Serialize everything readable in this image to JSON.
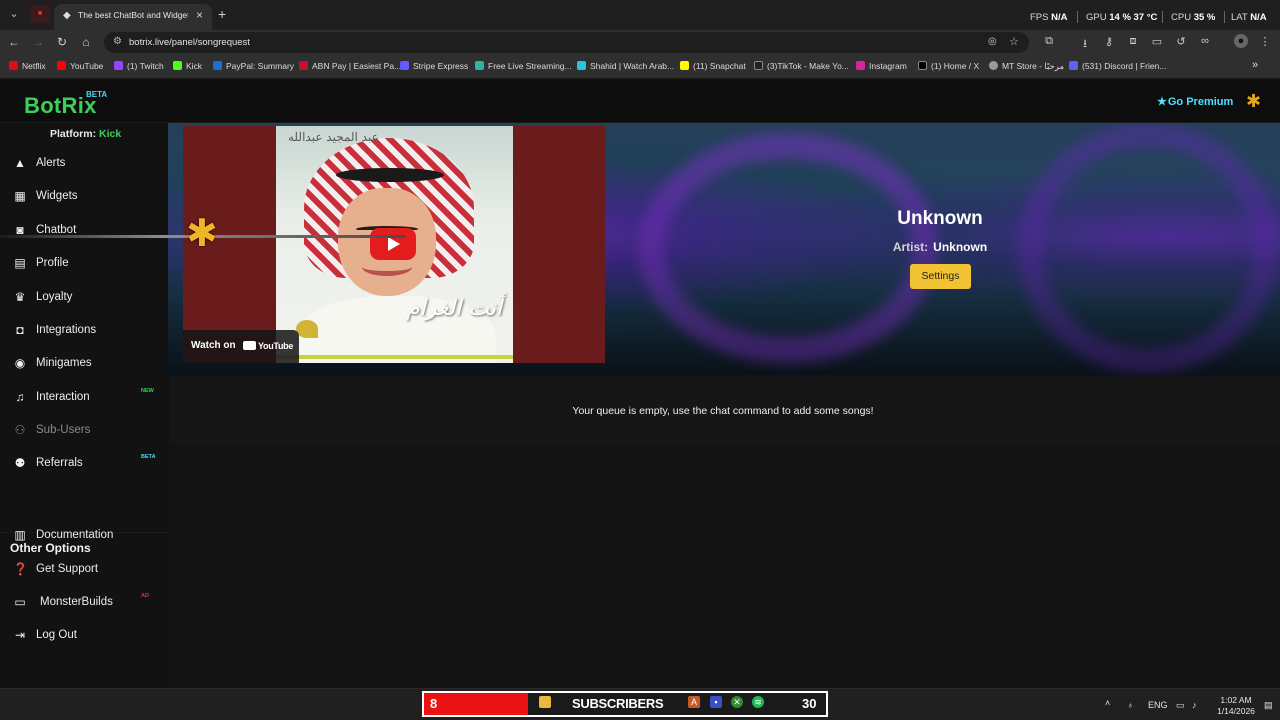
{
  "browser": {
    "tab_title": "The best ChatBot and Widgets",
    "url": "botrix.live/panel/songrequest",
    "perf": {
      "fps_label": "FPS",
      "fps_value": "N/A",
      "gpu_label": "GPU",
      "gpu_value": "14 %  37 °C",
      "cpu_label": "CPU",
      "cpu_value": "35 %",
      "lat_label": "LAT",
      "lat_value": "N/A"
    },
    "bookmarks": [
      {
        "label": "Netflix",
        "color": "#e50914"
      },
      {
        "label": "YouTube",
        "color": "#ff0000"
      },
      {
        "label": "(1) Twitch",
        "color": "#9146ff"
      },
      {
        "label": "Kick",
        "color": "#53fc18"
      },
      {
        "label": "PayPal: Summary",
        "color": "#1f6fd1"
      },
      {
        "label": "ABN Pay | Easiest Pa...",
        "color": "#c8102e"
      },
      {
        "label": "Stripe Express",
        "color": "#635bff"
      },
      {
        "label": "Free Live Streaming...",
        "color": "#2ab7a0"
      },
      {
        "label": "Shahid | Watch Arab...",
        "color": "#26c6da"
      },
      {
        "label": "(11) Snapchat",
        "color": "#fffc00"
      },
      {
        "label": "(3)TikTok - Make Yo...",
        "color": "#222222"
      },
      {
        "label": "Instagram",
        "color": "#d6249f"
      },
      {
        "label": "(1) Home / X",
        "color": "#000000"
      },
      {
        "label": "MT Store - مرحبًا",
        "color": "#9a9a9a"
      },
      {
        "label": "(531) Discord | Frien...",
        "color": "#5865f2"
      }
    ]
  },
  "app": {
    "logo": "BotRix",
    "logo_badge": "BETA",
    "premium": "Go Premium",
    "platform_label": "Platform:",
    "platform_value": "Kick",
    "nav": [
      {
        "label": "Alerts",
        "icon": "warning-icon"
      },
      {
        "label": "Widgets",
        "icon": "grid-icon"
      },
      {
        "label": "Chatbot",
        "icon": "robot-icon"
      },
      {
        "label": "Profile",
        "icon": "id-card-icon"
      },
      {
        "label": "Loyalty",
        "icon": "trophy-icon"
      },
      {
        "label": "Integrations",
        "icon": "integrations-icon"
      },
      {
        "label": "Minigames",
        "icon": "gamepad-icon"
      },
      {
        "label": "Interaction",
        "icon": "music-icon",
        "tag": "NEW"
      },
      {
        "label": "Sub-Users",
        "icon": "users-icon"
      },
      {
        "label": "Referrals",
        "icon": "referrals-icon",
        "tag": "BETA"
      }
    ],
    "other_options_title": "Other Options",
    "other_nav": [
      {
        "label": "Documentation",
        "icon": "book-icon"
      },
      {
        "label": "Get Support",
        "icon": "help-icon"
      },
      {
        "label": "MonsterBuilds",
        "icon": "laptop-icon",
        "tag": "AD"
      },
      {
        "label": "Log Out",
        "icon": "logout-icon"
      }
    ],
    "player": {
      "watch_on": "Watch on",
      "youtube": "YouTube",
      "thumb_text_top": "عبد المجيد عبدالله",
      "thumb_text_title": "أنت الغرام"
    },
    "song": {
      "title": "Unknown",
      "artist_label": "Artist:",
      "artist": "Unknown",
      "settings_button": "Settings"
    },
    "queue_message": "Your queue is empty, use the chat command to add some songs!"
  },
  "taskbar": {
    "sub_count_left": "8",
    "sub_word": "SUBSCRIBERS",
    "sub_count_right": "30",
    "lang": "ENG",
    "time": "1:02 AM",
    "date": "1/14/2026"
  }
}
